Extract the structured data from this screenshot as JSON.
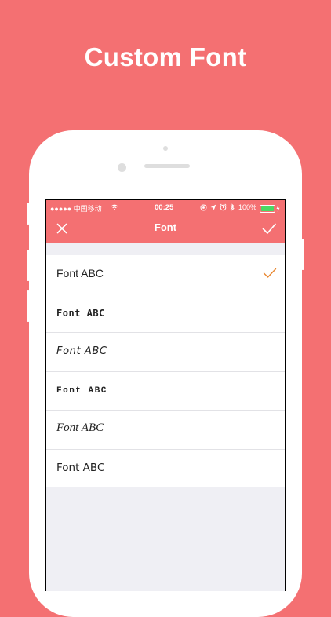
{
  "headline": "Custom Font",
  "status_bar": {
    "carrier": "●●●●● 中国移动",
    "time": "00:25",
    "battery": "100%",
    "battery_level": 1.0
  },
  "nav": {
    "title": "Font",
    "close_icon": "close-icon",
    "confirm_icon": "checkmark-icon"
  },
  "fonts": [
    {
      "label": "Font ABC",
      "selected": true
    },
    {
      "label": "Font ABC",
      "selected": false
    },
    {
      "label": "Font ABC",
      "selected": false
    },
    {
      "label": "Font ABC",
      "selected": false
    },
    {
      "label": "Font ABC",
      "selected": false
    },
    {
      "label": "Font ABC",
      "selected": false
    }
  ],
  "colors": {
    "accent": "#F47072",
    "checkmark": "#E8862F",
    "battery": "#4CD964"
  }
}
